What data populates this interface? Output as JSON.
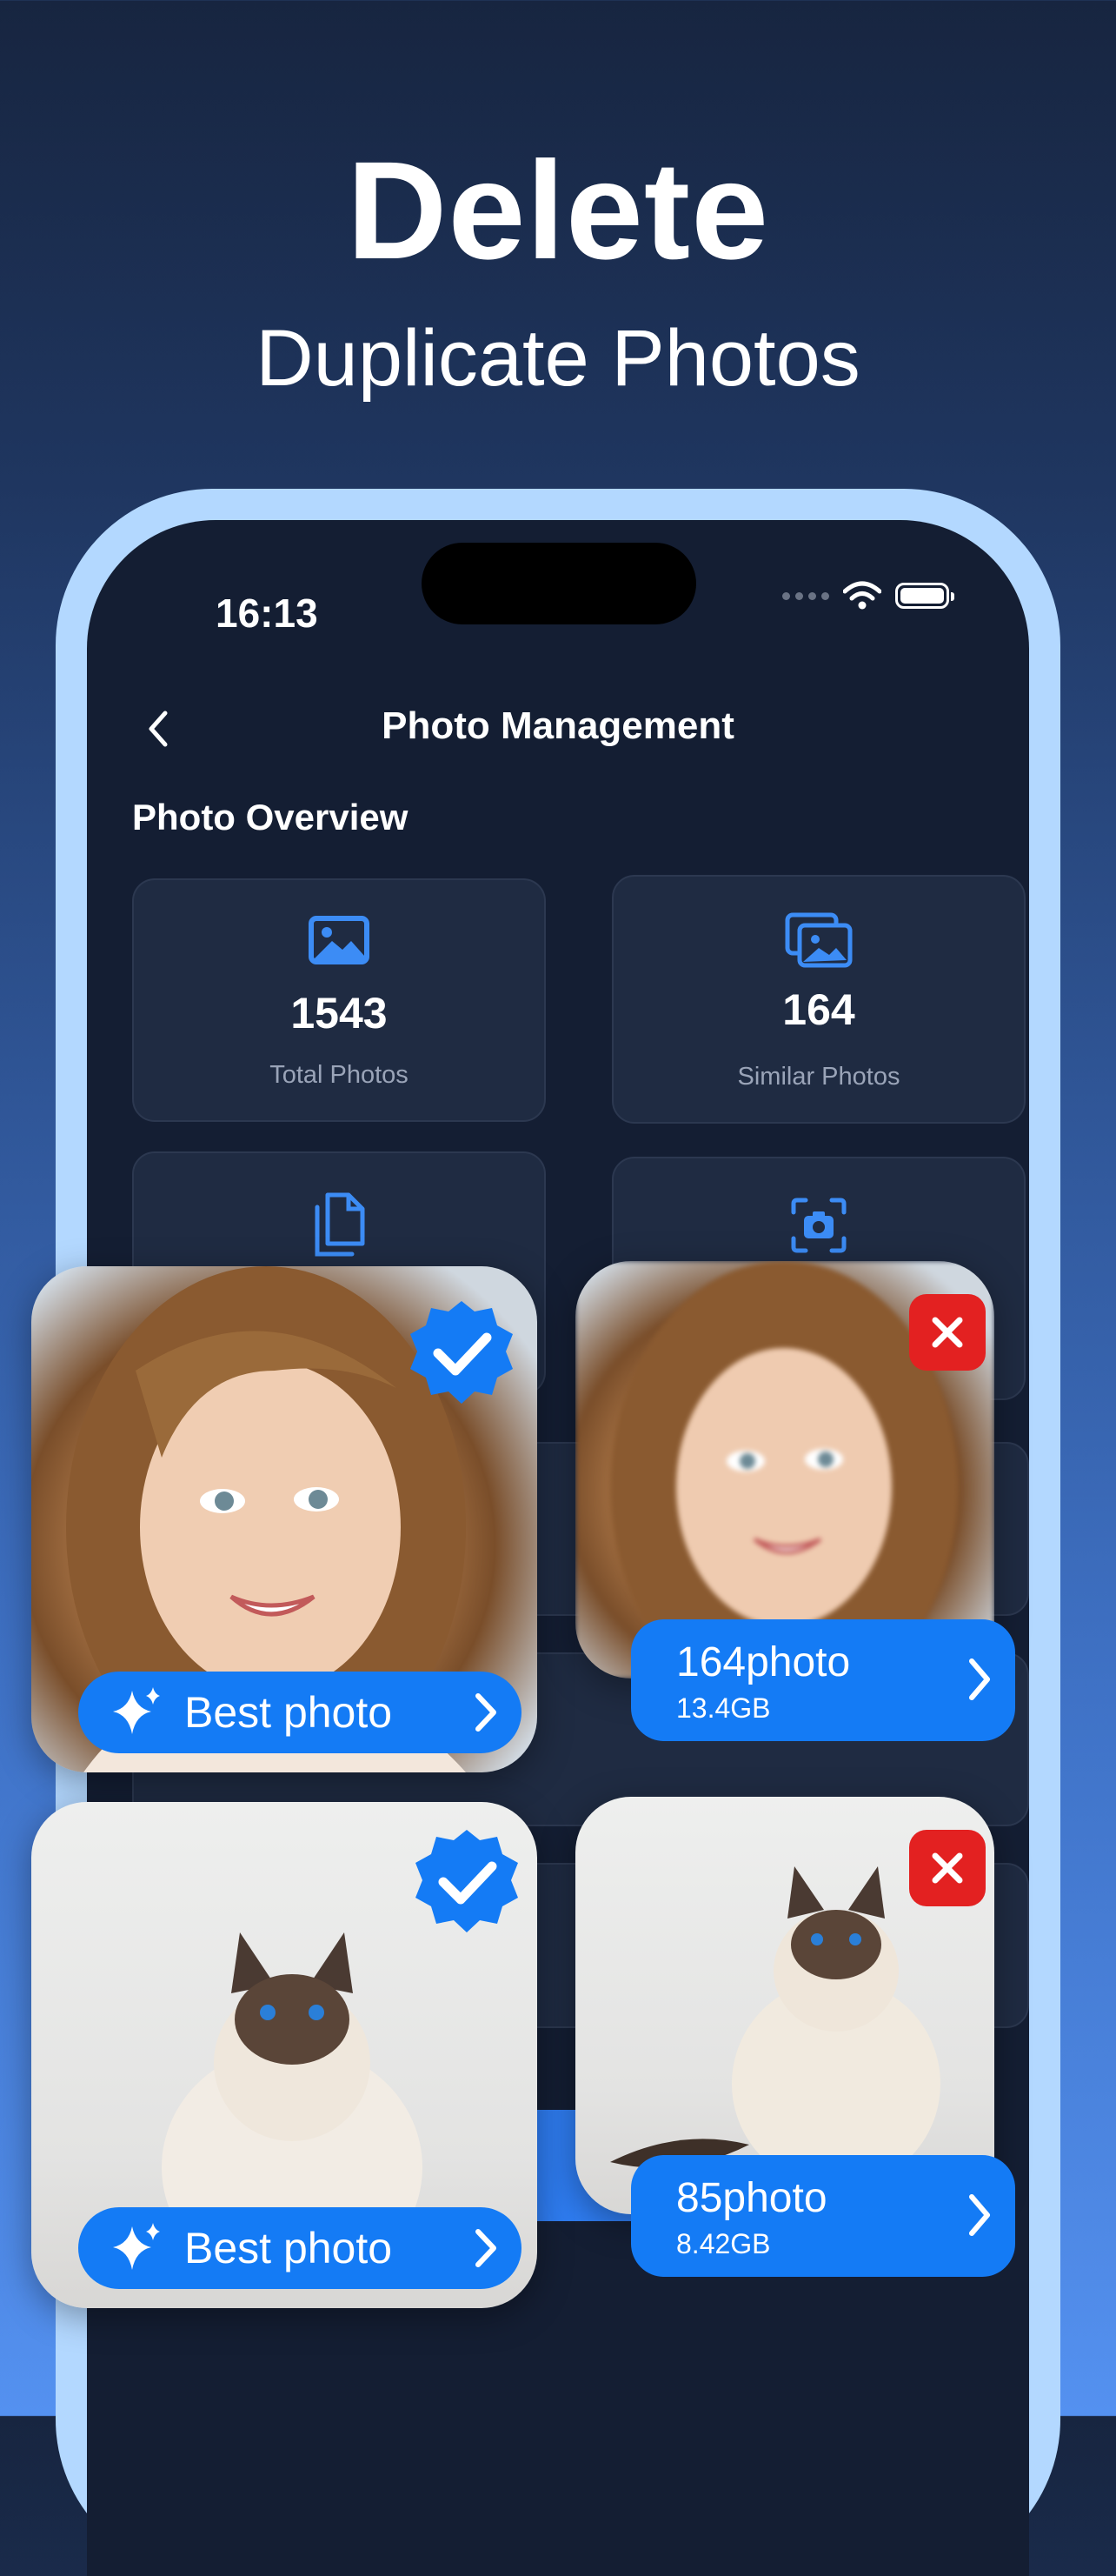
{
  "promo": {
    "title": "Delete",
    "subtitle": "Duplicate Photos"
  },
  "status_bar": {
    "time": "16:13"
  },
  "header": {
    "title": "Photo Management"
  },
  "overview": {
    "section_title": "Photo Overview",
    "cards": [
      {
        "icon": "image-icon",
        "value": "1543",
        "label": "Total Photos"
      },
      {
        "icon": "photos-stack-icon",
        "value": "164",
        "label": "Similar Photos"
      },
      {
        "icon": "duplicate-docs-icon"
      },
      {
        "icon": "screenshot-camera-icon"
      }
    ]
  },
  "overlay": {
    "best_label": "Best photo",
    "similar_group": {
      "count": "164photo",
      "size": "13.4GB"
    },
    "duplicate_group": {
      "count": "85photo",
      "size": "8.42GB"
    }
  },
  "colors": {
    "accent": "#147bf5",
    "delete_badge": "#e32121",
    "screen_bg": "#141e33",
    "card_bg": "#1f2b42",
    "phone_frame": "#b3d8ff"
  }
}
